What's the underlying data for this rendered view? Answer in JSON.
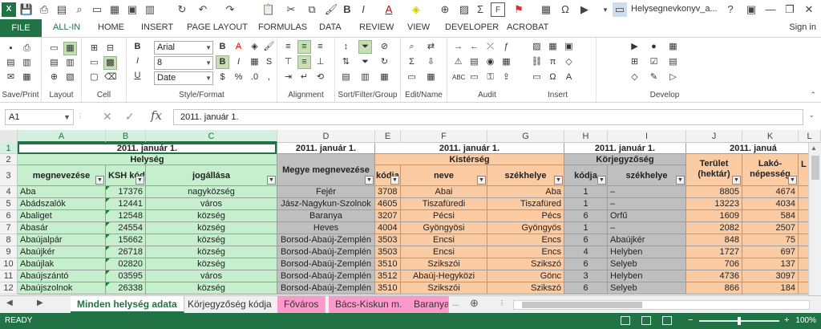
{
  "title_bar": {
    "doc_title": "Helysegnevkonyv_a...",
    "help": "?",
    "minimize": "—",
    "restore": "❐",
    "close": "✕"
  },
  "tabs": {
    "file": "FILE",
    "items": [
      "ALL-IN",
      "HOME",
      "INSERT",
      "PAGE LAYOUT",
      "FORMULAS",
      "DATA",
      "REVIEW",
      "VIEW",
      "DEVELOPER",
      "ACROBAT"
    ],
    "signin": "Sign in"
  },
  "ribbon": {
    "groups": [
      "Save/Print",
      "Layout",
      "Cell",
      "Style/Format",
      "Alignment",
      "Sort/Filter/Group",
      "Edit/Name",
      "Audit",
      "Insert",
      "Develop"
    ],
    "font_name": "Arial",
    "font_size": "8",
    "number_format": "Date"
  },
  "formula_bar": {
    "name_box": "A1",
    "fx": "fx",
    "content": "2011. január 1."
  },
  "columns": [
    "A",
    "B",
    "C",
    "D",
    "E",
    "F",
    "G",
    "H",
    "I",
    "J",
    "K",
    "L"
  ],
  "rows_header": {
    "r1": [
      "2011. január 1.",
      "2011. január 1.",
      "2011. január 1.",
      "2011. január 1.",
      "2011. januá"
    ],
    "helyseg": "Helység",
    "megye": "Megye megnevezése",
    "kisterseg": "Kistérség",
    "korjegyzoseg": "Körjegyzőség",
    "terulet": "Terület (hektár)",
    "lako": "Lakó-népesség",
    "lcol": "L",
    "r3": [
      "megnevezése",
      "KSH kódja",
      "jogállása",
      "kódja",
      "neve",
      "székhelye",
      "kódja",
      "székhelye"
    ]
  },
  "data_rows": [
    {
      "row": "4",
      "a": "Aba",
      "b": "17376",
      "c": "nagyközség",
      "d": "Fejér",
      "e": "3708",
      "f": "Abai",
      "g": "Aba",
      "h": "1",
      "i": "–",
      "j": "8805",
      "k": "4674"
    },
    {
      "row": "5",
      "a": "Abádszalók",
      "b": "12441",
      "c": "város",
      "d": "Jász-Nagykun-Szolnok",
      "e": "4605",
      "f": "Tiszafüredi",
      "g": "Tiszafüred",
      "h": "1",
      "i": "–",
      "j": "13223",
      "k": "4034"
    },
    {
      "row": "6",
      "a": "Abaliget",
      "b": "12548",
      "c": "község",
      "d": "Baranya",
      "e": "3207",
      "f": "Pécsi",
      "g": "Pécs",
      "h": "6",
      "i": "Orfű",
      "j": "1609",
      "k": "584"
    },
    {
      "row": "7",
      "a": "Abasár",
      "b": "24554",
      "c": "község",
      "d": "Heves",
      "e": "4004",
      "f": "Gyöngyösi",
      "g": "Gyöngyös",
      "h": "1",
      "i": "–",
      "j": "2082",
      "k": "2507"
    },
    {
      "row": "8",
      "a": "Abaújalpár",
      "b": "15662",
      "c": "község",
      "d": "Borsod-Abaúj-Zemplén",
      "e": "3503",
      "f": "Encsi",
      "g": "Encs",
      "h": "6",
      "i": "Abaújkér",
      "j": "848",
      "k": "75"
    },
    {
      "row": "9",
      "a": "Abaújkér",
      "b": "26718",
      "c": "község",
      "d": "Borsod-Abaúj-Zemplén",
      "e": "3503",
      "f": "Encsi",
      "g": "Encs",
      "h": "4",
      "i": "Helyben",
      "j": "1727",
      "k": "697"
    },
    {
      "row": "10",
      "a": "Abaújlak",
      "b": "02820",
      "c": "község",
      "d": "Borsod-Abaúj-Zemplén",
      "e": "3510",
      "f": "Szikszói",
      "g": "Szikszó",
      "h": "6",
      "i": "Selyeb",
      "j": "706",
      "k": "137"
    },
    {
      "row": "11",
      "a": "Abaújszántó",
      "b": "03595",
      "c": "város",
      "d": "Borsod-Abaúj-Zemplén",
      "e": "3512",
      "f": "Abaúj-Hegyközi",
      "g": "Gönc",
      "h": "3",
      "i": "Helyben",
      "j": "4736",
      "k": "3097"
    },
    {
      "row": "12",
      "a": "Abaújszolnok",
      "b": "26338",
      "c": "község",
      "d": "Borsod-Abaúj-Zemplén",
      "e": "3510",
      "f": "Szikszói",
      "g": "Szikszó",
      "h": "6",
      "i": "Selyeb",
      "j": "866",
      "k": "184"
    }
  ],
  "row_numbers": [
    "1",
    "2",
    "3"
  ],
  "sheets": [
    "Minden helység adata",
    "Körjegyzőség kódja",
    "Főváros",
    "Bács-Kiskun m.",
    "Baranya"
  ],
  "sheet_more": "...",
  "status": {
    "ready": "READY",
    "zoom": "100%"
  },
  "colors": {
    "excel_green": "#217346",
    "helyseg_green": "#c6efce",
    "megye_gray": "#bfbfbf",
    "kisterseg_orange": "#fbcba3",
    "sheet_pink": "#ff99cc"
  }
}
